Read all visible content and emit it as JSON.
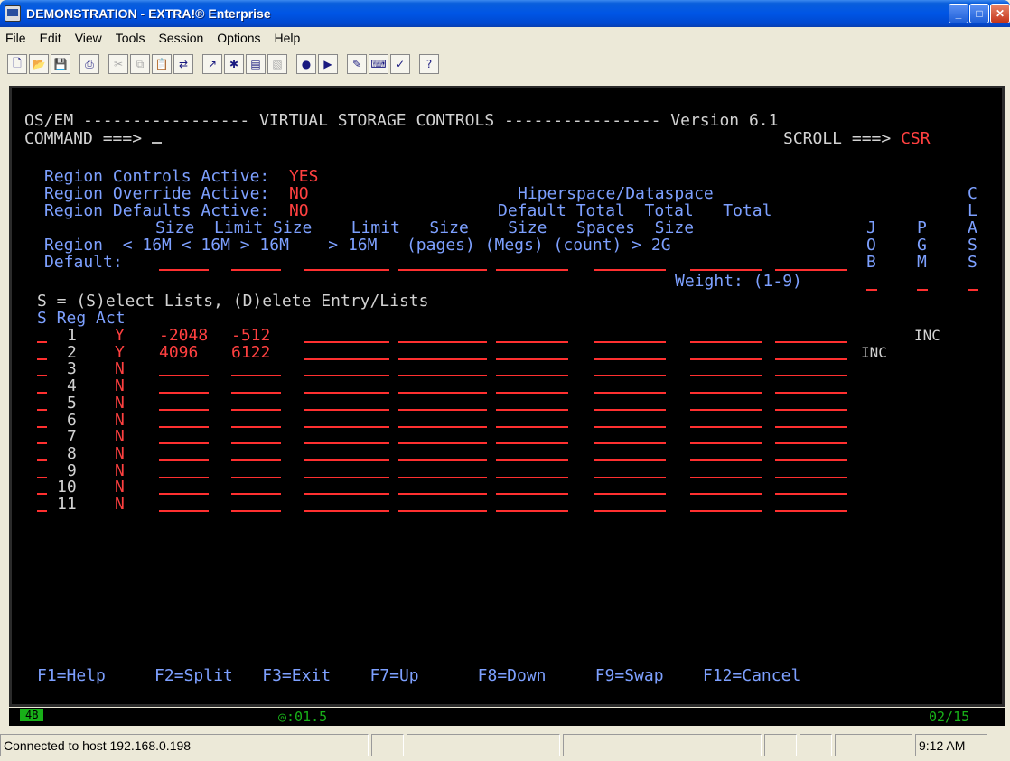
{
  "window": {
    "title": "DEMONSTRATION - EXTRA!® Enterprise",
    "buttons": [
      "minimize",
      "maximize",
      "close"
    ]
  },
  "menu": [
    "File",
    "Edit",
    "View",
    "Tools",
    "Session",
    "Options",
    "Help"
  ],
  "toolbar_icons": [
    "new-icon",
    "open-icon",
    "save-icon",
    "print-icon",
    "cut-icon",
    "copy-icon",
    "paste-icon",
    "transfer-icon",
    "send-icon",
    "tools-icon",
    "macro-icon",
    "settings-icon",
    "record-icon",
    "play-icon",
    "edit-icon",
    "keyboard-icon",
    "hotspot-icon",
    "help-pointer-icon"
  ],
  "screen": {
    "header_left": "OS/EM",
    "header_center": "VIRTUAL STORAGE CONTROLS",
    "header_right": "Version 6.1",
    "command_label": "COMMAND ===>",
    "scroll_label": "SCROLL ===>",
    "scroll_value": "CSR",
    "region_controls_label": "Region Controls Active:",
    "region_controls_value": "YES",
    "region_override_label": "Region Override Active:",
    "region_override_value": "NO",
    "region_defaults_label": "Region Defaults Active:",
    "region_defaults_value": "NO",
    "hiperspace_label": "Hiperspace/Dataspace",
    "col_header_1": "Default Total  Total   Total",
    "col_header_2": "Size  Limit Size    Limit   Size    Size   Spaces  Size",
    "col_header_3": "Region  < 16M < 16M > 16M    > 16M   (pages) (Megs) (count) > 2G",
    "default_label": "Default:",
    "weight_label": "Weight:",
    "weight_range": "(1-9)",
    "vertical_headers": {
      "job": "JOB",
      "pgm": "PGM",
      "class": "CLASS"
    },
    "select_help": "S = (S)elect Lists, (D)elete Entry/Lists",
    "list_header": "S Reg Act",
    "rows": [
      {
        "reg": "1",
        "act": "Y",
        "size_lt16": "-2048",
        "limit_lt16": "-512",
        "inc_col": "pgm",
        "inc": "INC"
      },
      {
        "reg": "2",
        "act": "Y",
        "size_lt16": "4096",
        "limit_lt16": "6122",
        "inc_col": "job",
        "inc": "INC"
      },
      {
        "reg": "3",
        "act": "N"
      },
      {
        "reg": "4",
        "act": "N"
      },
      {
        "reg": "5",
        "act": "N"
      },
      {
        "reg": "6",
        "act": "N"
      },
      {
        "reg": "7",
        "act": "N"
      },
      {
        "reg": "8",
        "act": "N"
      },
      {
        "reg": "9",
        "act": "N"
      },
      {
        "reg": "10",
        "act": "N"
      },
      {
        "reg": "11",
        "act": "N"
      }
    ],
    "pf_keys": "F1=Help     F2=Split   F3=Exit    F7=Up      F8=Down     F9=Swap    F12=Cancel"
  },
  "oia": {
    "session_indicator": "4B",
    "timer": "◎:01.5",
    "cursor_pos": "02/15"
  },
  "statusbar": {
    "connection": "Connected to host 192.168.0.198",
    "time": "9:12 AM"
  },
  "colors": {
    "field_red": "#ff3030",
    "label_blue": "#7da0ff",
    "text_white": "#d2d2d2",
    "oia_green": "#18b018"
  }
}
